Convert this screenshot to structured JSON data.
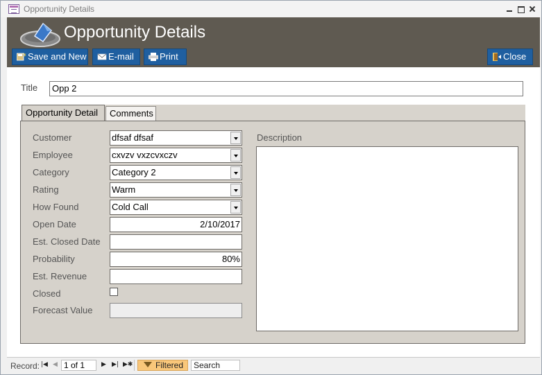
{
  "window": {
    "title": "Opportunity Details"
  },
  "header": {
    "title": "Opportunity Details",
    "background": "#5f5a51",
    "buttons": {
      "save_new": "Save and New",
      "email": "E-mail",
      "print": "Print",
      "close": "Close"
    },
    "button_color": "#1f5fa0"
  },
  "form": {
    "title_label": "Title",
    "title_value": "Opp 2",
    "tabs": [
      {
        "label": "Opportunity Detail",
        "selected": true
      },
      {
        "label": "Comments",
        "selected": false
      }
    ],
    "fields": {
      "customer": {
        "label": "Customer",
        "value": "dfsaf dfsaf"
      },
      "employee": {
        "label": "Employee",
        "value": "cxvzv vxzcvxczv"
      },
      "category": {
        "label": "Category",
        "value": "Category 2"
      },
      "rating": {
        "label": "Rating",
        "value": "Warm"
      },
      "how_found": {
        "label": "How Found",
        "value": "Cold Call"
      },
      "open_date": {
        "label": "Open Date",
        "value": "2/10/2017"
      },
      "est_closed_date": {
        "label": "Est. Closed Date",
        "value": ""
      },
      "probability": {
        "label": "Probability",
        "value": "80%"
      },
      "est_revenue": {
        "label": "Est. Revenue",
        "value": ""
      },
      "closed": {
        "label": "Closed",
        "checked": false
      },
      "forecast_value": {
        "label": "Forecast Value",
        "value": ""
      }
    },
    "description": {
      "label": "Description",
      "value": ""
    }
  },
  "statusbar": {
    "record_label": "Record:",
    "position": "1 of 1",
    "filter_label": "Filtered",
    "search_label": "Search",
    "filter_color": "#f9c77a"
  }
}
